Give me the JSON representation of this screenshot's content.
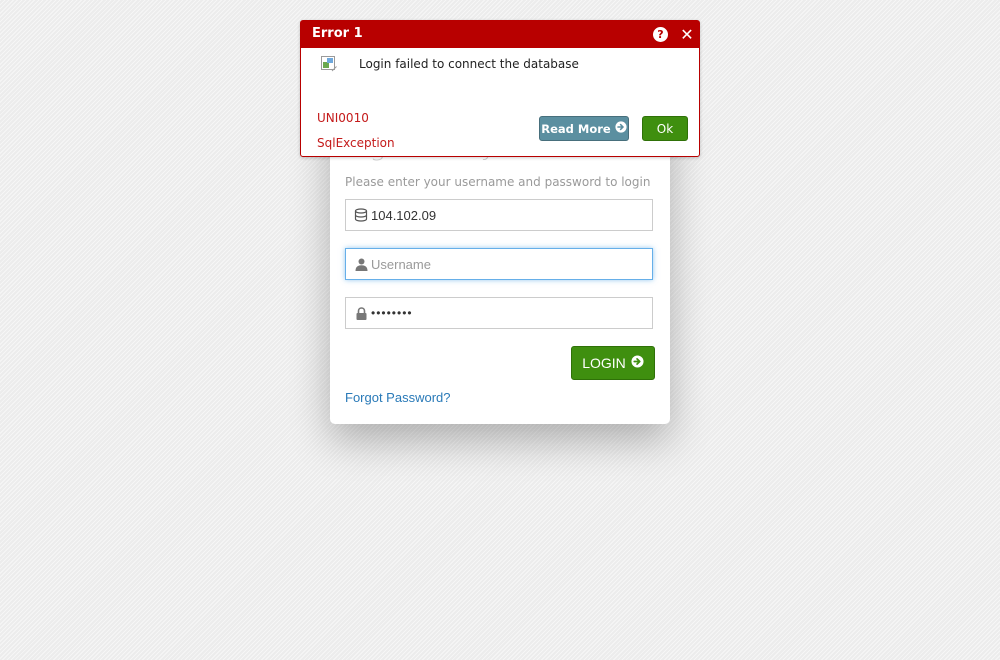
{
  "login": {
    "title": "Sign in to your account",
    "subtitle": "Please enter your username and password to login",
    "server_value": "104.102.09",
    "server_icon": "database-icon",
    "username_placeholder": "Username",
    "username_icon": "user-icon",
    "password_value": "••••••••",
    "password_icon": "lock-icon",
    "login_label": "LOGIN",
    "login_icon": "arrow-circle-right-icon",
    "forgot_label": "Forgot Password?"
  },
  "error_dialog": {
    "title": "Error 1",
    "help_icon": "question-circle-icon",
    "close_icon": "close-icon",
    "message": "Login failed to connect the database",
    "code": "UNI0010",
    "exception_type": "SqlException",
    "read_more_label": "Read More",
    "ok_label": "Ok"
  },
  "colors": {
    "error_red": "#b80000",
    "error_text_red": "#c41a1a",
    "success_green": "#3f8f0f",
    "read_more_teal": "#5b8fa0",
    "link_blue": "#2a7ab8",
    "focus_blue": "#66afe9"
  }
}
